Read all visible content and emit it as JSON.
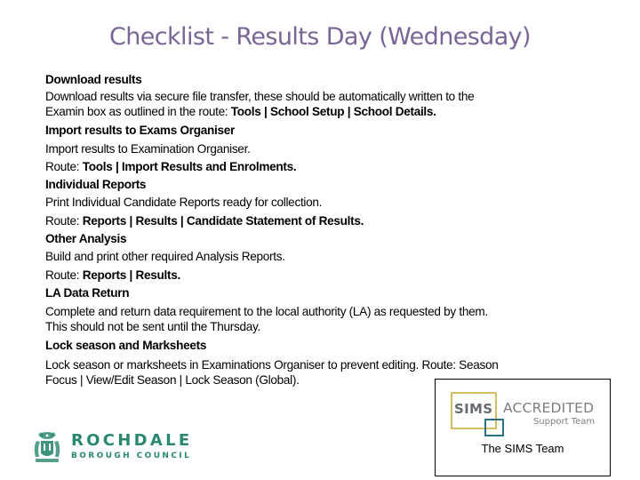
{
  "title": "Checklist  - Results Day (Wednesday)",
  "sections": [
    {
      "heading": "Download results",
      "lines": [
        {
          "text": "Download results via secure file transfer, these should be automatically written to the"
        },
        {
          "text": "Examin box as outlined in the route: ",
          "bold": "Tools | School Setup | School Details."
        }
      ]
    },
    {
      "heading": "Import results to Exams Organiser",
      "lines": [
        {
          "text": "Import results to Examination Organiser."
        },
        {
          "text": "Route: ",
          "bold": "Tools | Import Results and Enrolments."
        }
      ]
    },
    {
      "heading": "Individual Reports",
      "lines": [
        {
          "text": "Print Individual Candidate Reports ready for collection."
        },
        {
          "text": "Route: ",
          "bold": "Reports | Results | Candidate Statement of Results."
        }
      ]
    },
    {
      "heading": "Other Analysis",
      "lines": [
        {
          "text": "Build and print other required Analysis Reports."
        },
        {
          "text": "Route: ",
          "bold": "Reports | Results."
        }
      ]
    },
    {
      "heading": "LA Data Return",
      "lines": [
        {
          "text": "Complete and return data requirement to the local authority (LA) as requested by them."
        },
        {
          "text": "This should not be sent until the Thursday."
        }
      ]
    },
    {
      "heading": "Lock season and Marksheets",
      "lines": [
        {
          "text": "Lock season or marksheets in Examinations Organiser to prevent editing. Route: Season"
        },
        {
          "text": "Focus | View/Edit Season | Lock Season  (Global)."
        }
      ]
    }
  ],
  "sims_logo": {
    "sims": "SIMS",
    "accredited": "ACCREDITED",
    "support_team": "Support Team",
    "caption": "The SIMS Team",
    "gold_color": "#d9bb62",
    "blue_color": "#2d6d86"
  },
  "council_logo": {
    "name": "ROCHDALE",
    "subtitle": "BOROUGH COUNCIL",
    "color": "#2a8870"
  },
  "colors": {
    "title": "#7a6597",
    "text": "#000000"
  }
}
